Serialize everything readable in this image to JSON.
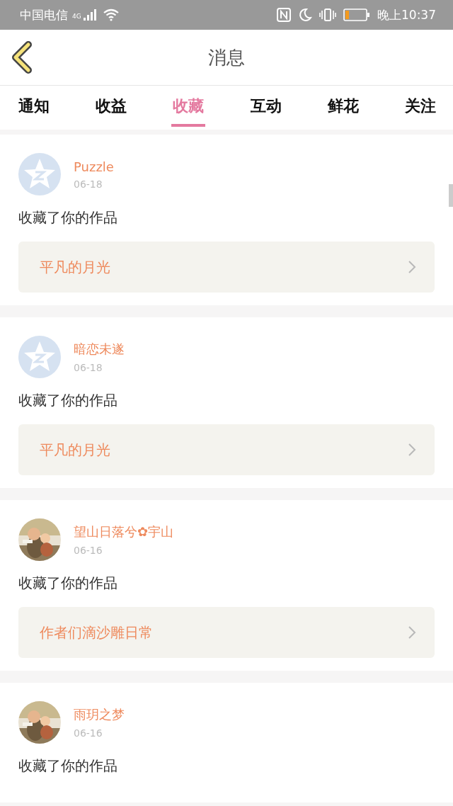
{
  "status_bar": {
    "carrier": "中国电信",
    "network": "4G",
    "time": "晚上10:37"
  },
  "header": {
    "title": "消息"
  },
  "tabs": [
    {
      "label": "通知",
      "selected": false
    },
    {
      "label": "收益",
      "selected": false
    },
    {
      "label": "收藏",
      "selected": true
    },
    {
      "label": "互动",
      "selected": false
    },
    {
      "label": "鲜花",
      "selected": false
    },
    {
      "label": "关注",
      "selected": false
    }
  ],
  "messages": [
    {
      "user": "Puzzle",
      "date": "06-18",
      "avatar": {
        "kind": "default"
      },
      "action": "收藏了你的作品",
      "work": "平凡的月光"
    },
    {
      "user": "暗恋未遂",
      "date": "06-18",
      "avatar": {
        "kind": "default"
      },
      "action": "收藏了你的作品",
      "work": "平凡的月光"
    },
    {
      "user": "望山日落兮✿宇山",
      "date": "06-16",
      "action": "收藏了你的作品",
      "work": "作者们滴沙雕日常"
    },
    {
      "user": "雨玥之梦",
      "date": "06-16",
      "action": "收藏了你的作品"
    }
  ]
}
